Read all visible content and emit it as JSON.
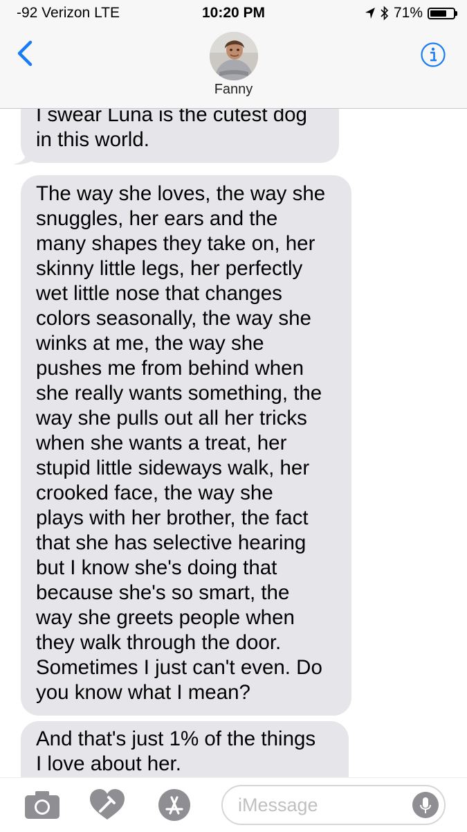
{
  "status_bar": {
    "carrier": "-92 Verizon  LTE",
    "time": "10:20 PM",
    "battery_percent": "71%",
    "battery_level": 0.71
  },
  "header": {
    "contact_name": "Fanny",
    "back_icon": "chevron-left-icon",
    "info_icon": "info-icon",
    "accent_color": "#1a7cf5"
  },
  "messages": [
    {
      "direction": "incoming",
      "text": "I swear Luna is the cutest dog\nin this world."
    },
    {
      "direction": "incoming",
      "text": "The way she loves, the way she\nsnuggles, her ears and the\nmany shapes they take on, her\nskinny little legs, her perfectly\nwet little nose that changes\ncolors seasonally, the way she\nwinks at me, the way she\npushes me from behind when\nshe really wants something, the\nway she pulls out all her tricks\nwhen she wants a treat, her\nstupid little sideways walk, her\ncrooked face, the way she\nplays with her brother, the fact\nthat she has selective hearing\nbut I know she's doing that\nbecause she's so smart, the\nway she greets people when\nthey walk through the door.\nSometimes I just can't even. Do\nyou know what I mean?"
    },
    {
      "direction": "incoming",
      "text": "And that's just 1% of the things\nI love about her."
    }
  ],
  "input_bar": {
    "placeholder": "iMessage",
    "icons": [
      "camera-icon",
      "digital-touch-icon",
      "app-store-icon",
      "microphone-icon"
    ]
  },
  "colors": {
    "incoming_bubble": "#e5e5ea",
    "bar_background": "#f7f7f7",
    "icon_gray": "#8e8e93"
  }
}
